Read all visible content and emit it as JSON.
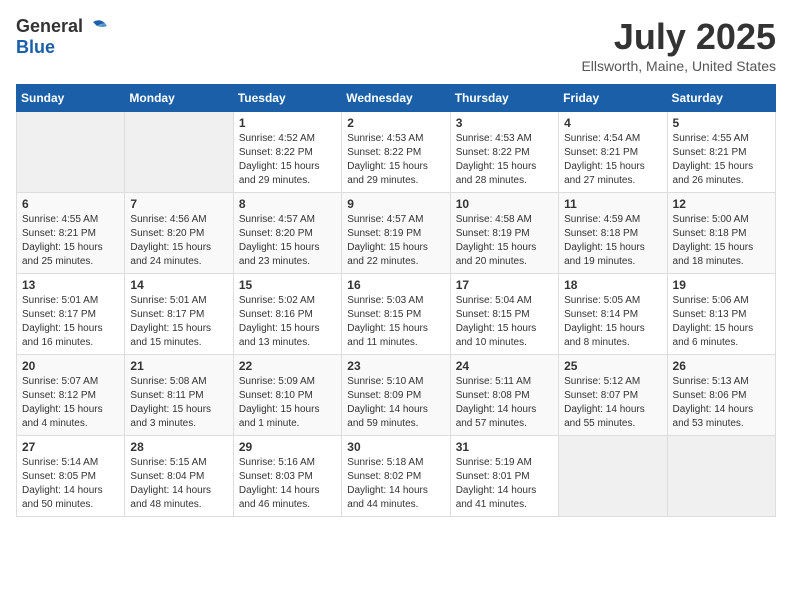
{
  "logo": {
    "general": "General",
    "blue": "Blue"
  },
  "title": "July 2025",
  "location": "Ellsworth, Maine, United States",
  "weekdays": [
    "Sunday",
    "Monday",
    "Tuesday",
    "Wednesday",
    "Thursday",
    "Friday",
    "Saturday"
  ],
  "weeks": [
    [
      {
        "day": "",
        "info": ""
      },
      {
        "day": "",
        "info": ""
      },
      {
        "day": "1",
        "sunrise": "4:52 AM",
        "sunset": "8:22 PM",
        "daylight": "15 hours and 29 minutes."
      },
      {
        "day": "2",
        "sunrise": "4:53 AM",
        "sunset": "8:22 PM",
        "daylight": "15 hours and 29 minutes."
      },
      {
        "day": "3",
        "sunrise": "4:53 AM",
        "sunset": "8:22 PM",
        "daylight": "15 hours and 28 minutes."
      },
      {
        "day": "4",
        "sunrise": "4:54 AM",
        "sunset": "8:21 PM",
        "daylight": "15 hours and 27 minutes."
      },
      {
        "day": "5",
        "sunrise": "4:55 AM",
        "sunset": "8:21 PM",
        "daylight": "15 hours and 26 minutes."
      }
    ],
    [
      {
        "day": "6",
        "sunrise": "4:55 AM",
        "sunset": "8:21 PM",
        "daylight": "15 hours and 25 minutes."
      },
      {
        "day": "7",
        "sunrise": "4:56 AM",
        "sunset": "8:20 PM",
        "daylight": "15 hours and 24 minutes."
      },
      {
        "day": "8",
        "sunrise": "4:57 AM",
        "sunset": "8:20 PM",
        "daylight": "15 hours and 23 minutes."
      },
      {
        "day": "9",
        "sunrise": "4:57 AM",
        "sunset": "8:19 PM",
        "daylight": "15 hours and 22 minutes."
      },
      {
        "day": "10",
        "sunrise": "4:58 AM",
        "sunset": "8:19 PM",
        "daylight": "15 hours and 20 minutes."
      },
      {
        "day": "11",
        "sunrise": "4:59 AM",
        "sunset": "8:18 PM",
        "daylight": "15 hours and 19 minutes."
      },
      {
        "day": "12",
        "sunrise": "5:00 AM",
        "sunset": "8:18 PM",
        "daylight": "15 hours and 18 minutes."
      }
    ],
    [
      {
        "day": "13",
        "sunrise": "5:01 AM",
        "sunset": "8:17 PM",
        "daylight": "15 hours and 16 minutes."
      },
      {
        "day": "14",
        "sunrise": "5:01 AM",
        "sunset": "8:17 PM",
        "daylight": "15 hours and 15 minutes."
      },
      {
        "day": "15",
        "sunrise": "5:02 AM",
        "sunset": "8:16 PM",
        "daylight": "15 hours and 13 minutes."
      },
      {
        "day": "16",
        "sunrise": "5:03 AM",
        "sunset": "8:15 PM",
        "daylight": "15 hours and 11 minutes."
      },
      {
        "day": "17",
        "sunrise": "5:04 AM",
        "sunset": "8:15 PM",
        "daylight": "15 hours and 10 minutes."
      },
      {
        "day": "18",
        "sunrise": "5:05 AM",
        "sunset": "8:14 PM",
        "daylight": "15 hours and 8 minutes."
      },
      {
        "day": "19",
        "sunrise": "5:06 AM",
        "sunset": "8:13 PM",
        "daylight": "15 hours and 6 minutes."
      }
    ],
    [
      {
        "day": "20",
        "sunrise": "5:07 AM",
        "sunset": "8:12 PM",
        "daylight": "15 hours and 4 minutes."
      },
      {
        "day": "21",
        "sunrise": "5:08 AM",
        "sunset": "8:11 PM",
        "daylight": "15 hours and 3 minutes."
      },
      {
        "day": "22",
        "sunrise": "5:09 AM",
        "sunset": "8:10 PM",
        "daylight": "15 hours and 1 minute."
      },
      {
        "day": "23",
        "sunrise": "5:10 AM",
        "sunset": "8:09 PM",
        "daylight": "14 hours and 59 minutes."
      },
      {
        "day": "24",
        "sunrise": "5:11 AM",
        "sunset": "8:08 PM",
        "daylight": "14 hours and 57 minutes."
      },
      {
        "day": "25",
        "sunrise": "5:12 AM",
        "sunset": "8:07 PM",
        "daylight": "14 hours and 55 minutes."
      },
      {
        "day": "26",
        "sunrise": "5:13 AM",
        "sunset": "8:06 PM",
        "daylight": "14 hours and 53 minutes."
      }
    ],
    [
      {
        "day": "27",
        "sunrise": "5:14 AM",
        "sunset": "8:05 PM",
        "daylight": "14 hours and 50 minutes."
      },
      {
        "day": "28",
        "sunrise": "5:15 AM",
        "sunset": "8:04 PM",
        "daylight": "14 hours and 48 minutes."
      },
      {
        "day": "29",
        "sunrise": "5:16 AM",
        "sunset": "8:03 PM",
        "daylight": "14 hours and 46 minutes."
      },
      {
        "day": "30",
        "sunrise": "5:18 AM",
        "sunset": "8:02 PM",
        "daylight": "14 hours and 44 minutes."
      },
      {
        "day": "31",
        "sunrise": "5:19 AM",
        "sunset": "8:01 PM",
        "daylight": "14 hours and 41 minutes."
      },
      {
        "day": "",
        "info": ""
      },
      {
        "day": "",
        "info": ""
      }
    ]
  ]
}
